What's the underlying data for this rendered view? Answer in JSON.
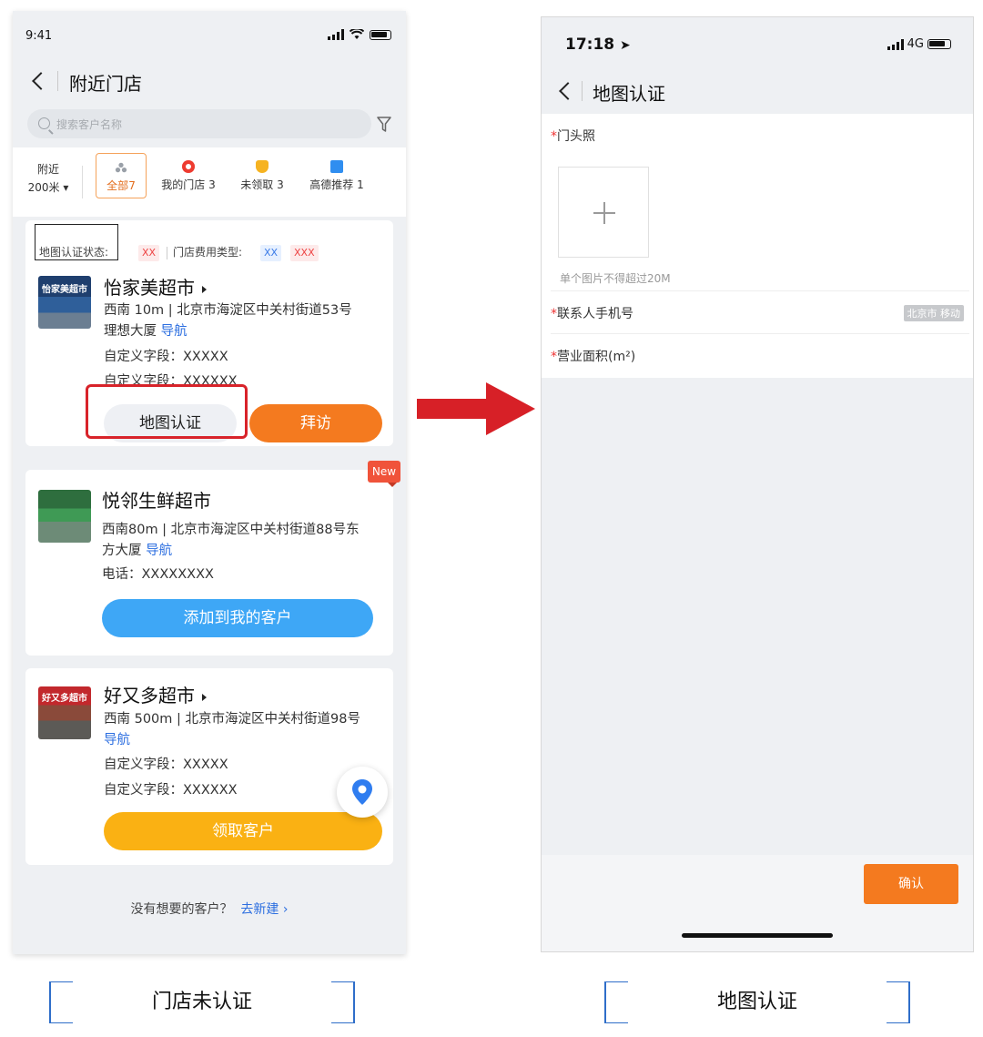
{
  "left": {
    "status_time": "9:41",
    "title": "附近门店",
    "search_placeholder": "搜索客户名称",
    "nearby": {
      "label": "附近",
      "distance": "200米"
    },
    "chips": [
      {
        "label": "全部",
        "count": "7"
      },
      {
        "label": "我的门店",
        "count": "3"
      },
      {
        "label": "未领取",
        "count": "3"
      },
      {
        "label": "高德推荐",
        "count": "1"
      }
    ],
    "card1": {
      "map_status_label": "地图认证状态:",
      "map_status_value": "XX",
      "fee_type_label": "门店费用类型:",
      "fee_tag_1": "XX",
      "fee_tag_2": "XXX",
      "name": "怡家美超市",
      "address_line1": "西南 10m | 北京市海淀区中关村街道53号",
      "address_line2": "理想大厦",
      "nav": "导航",
      "field1": "自定义字段：XXXXX",
      "field2": "自定义字段：XXXXXX",
      "btn_map_auth": "地图认证",
      "btn_visit": "拜访",
      "img_text": "怡家美超市"
    },
    "card2": {
      "badge": "New",
      "name": "悦邻生鲜超市",
      "address_line1": "西南80m | 北京市海淀区中关村街道88号东",
      "address_line2": "方大厦",
      "nav": "导航",
      "phone": "电话：XXXXXXXX",
      "btn_add": "添加到我的客户"
    },
    "card3": {
      "name": "好又多超市",
      "address_line1": "西南 500m | 北京市海淀区中关村街道98号",
      "nav": "导航",
      "field1": "自定义字段：XXXXX",
      "field2": "自定义字段：XXXXXX",
      "btn_claim": "领取客户",
      "img_text": "好又多超市"
    },
    "footer_question": "没有想要的客户？",
    "footer_link": "去新建 ›",
    "caption": "门店未认证"
  },
  "right": {
    "status_time": "17:18",
    "network": "4G",
    "title": "地图认证",
    "field_photo": "门头照",
    "upload_hint": "单个图片不得超过20M",
    "field_phone": "联系人手机号",
    "carrier": "北京市 移动",
    "field_area": "营业面积(m²)",
    "confirm": "确认",
    "caption": "地图认证"
  },
  "colors": {
    "accent_orange": "#f47a1f",
    "link_blue": "#2d6fe0",
    "highlight_red": "#d8232a",
    "add_blue": "#3ea7f6",
    "claim_amber": "#fab113"
  },
  "icons": [
    "back-icon",
    "search-icon",
    "filter-icon",
    "location-pin-icon",
    "plus-icon",
    "arrow-right-icon"
  ]
}
